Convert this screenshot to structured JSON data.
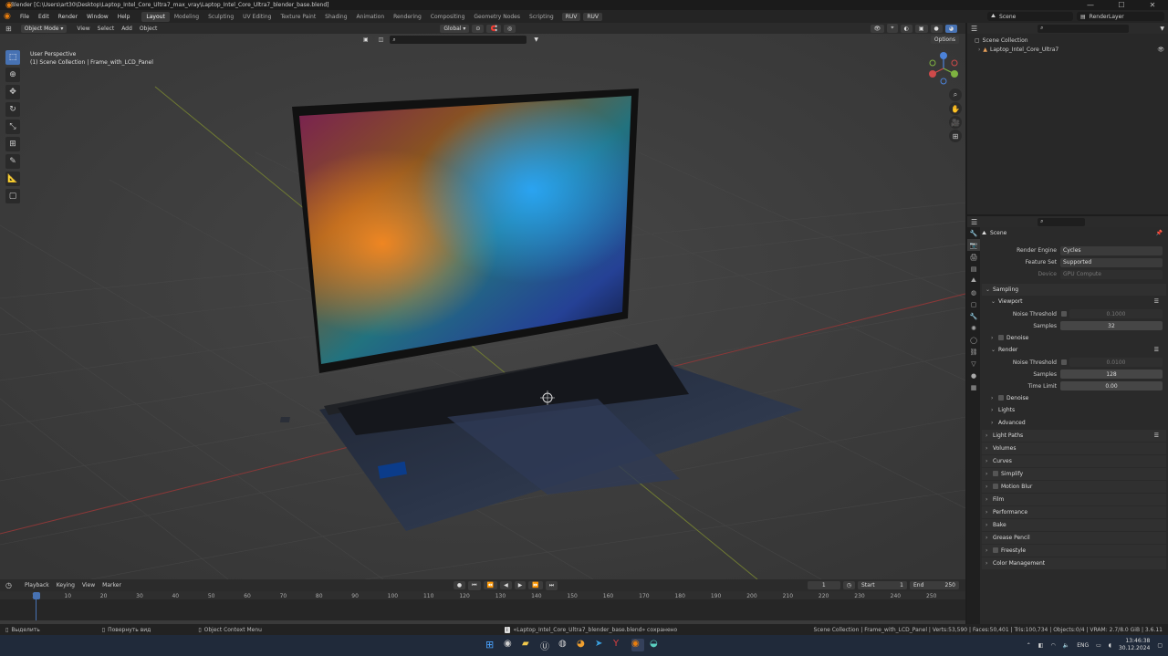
{
  "titlebar": {
    "title": "Blender [C:\\Users\\art30\\Desktop\\Laptop_Intel_Core_Ultra7_max_vray\\Laptop_Intel_Core_Ultra7_blender_base.blend]",
    "min": "—",
    "max": "☐",
    "close": "✕"
  },
  "menu": [
    "File",
    "Edit",
    "Render",
    "Window",
    "Help"
  ],
  "workspaces": [
    "Layout",
    "Modeling",
    "Sculpting",
    "UV Editing",
    "Texture Paint",
    "Shading",
    "Animation",
    "Rendering",
    "Compositing",
    "Geometry Nodes",
    "Scripting"
  ],
  "ruv1": "RUV",
  "ruv2": "RUV",
  "scene_name": "Scene",
  "view_layer": "RenderLayer",
  "viewport_header": {
    "mode": "Object Mode",
    "menus": [
      "View",
      "Select",
      "Add",
      "Object"
    ],
    "transform": "Global",
    "options": "Options"
  },
  "viewport": {
    "line1": "User Perspective",
    "line2": "(1) Scene Collection | Frame_with_LCD_Panel",
    "gizmo_x": "X",
    "gizmo_y": "Y",
    "gizmo_z": "Z"
  },
  "outliner": {
    "root": "Scene Collection",
    "item": "Laptop_Intel_Core_Ultra7"
  },
  "properties": {
    "context": "Scene",
    "render_engine_label": "Render Engine",
    "render_engine": "Cycles",
    "feature_set_label": "Feature Set",
    "feature_set": "Supported",
    "device_label": "Device",
    "device": "GPU Compute",
    "sampling": "Sampling",
    "viewport": "Viewport",
    "vp_noise_label": "Noise Threshold",
    "vp_noise": "0.1000",
    "vp_samples_label": "Samples",
    "vp_samples": "32",
    "denoise": "Denoise",
    "render": "Render",
    "r_noise_label": "Noise Threshold",
    "r_noise": "0.0100",
    "r_samples_label": "Samples",
    "r_samples": "128",
    "time_limit_label": "Time Limit",
    "time_limit": "0.00",
    "denoise2": "Denoise",
    "lights": "Lights",
    "advanced": "Advanced",
    "panels": [
      "Light Paths",
      "Volumes",
      "Curves",
      "Simplify",
      "Motion Blur",
      "Film",
      "Performance",
      "Bake",
      "Grease Pencil",
      "Freestyle",
      "Color Management"
    ]
  },
  "timeline": {
    "menus": [
      "Playback",
      "Keying",
      "View",
      "Marker"
    ],
    "current": "1",
    "start_label": "Start",
    "start": "1",
    "end_label": "End",
    "end": "250",
    "ticks": [
      "1",
      "10",
      "20",
      "30",
      "40",
      "50",
      "60",
      "70",
      "80",
      "90",
      "100",
      "110",
      "120",
      "130",
      "140",
      "150",
      "160",
      "170",
      "180",
      "190",
      "200",
      "210",
      "220",
      "230",
      "240",
      "250"
    ]
  },
  "status": {
    "select": "Выделить",
    "rotate": "Повернуть вид",
    "context": "Object Context Menu",
    "saved": "«Laptop_Intel_Core_Ultra7_blender_base.blend» сохранено",
    "stats": "Scene Collection | Frame_with_LCD_Panel | Verts:53,590 | Faces:50,401 | Tris:100,734 | Objects:0/4 | VRAM: 2.7/8.0 GiB | 3.6.11"
  },
  "taskbar": {
    "lang": "ENG",
    "time": "13:46:38",
    "date": "30.12.2024"
  },
  "colors": {
    "accent": "#4772b3",
    "blender_orange": "#e87d0d"
  }
}
